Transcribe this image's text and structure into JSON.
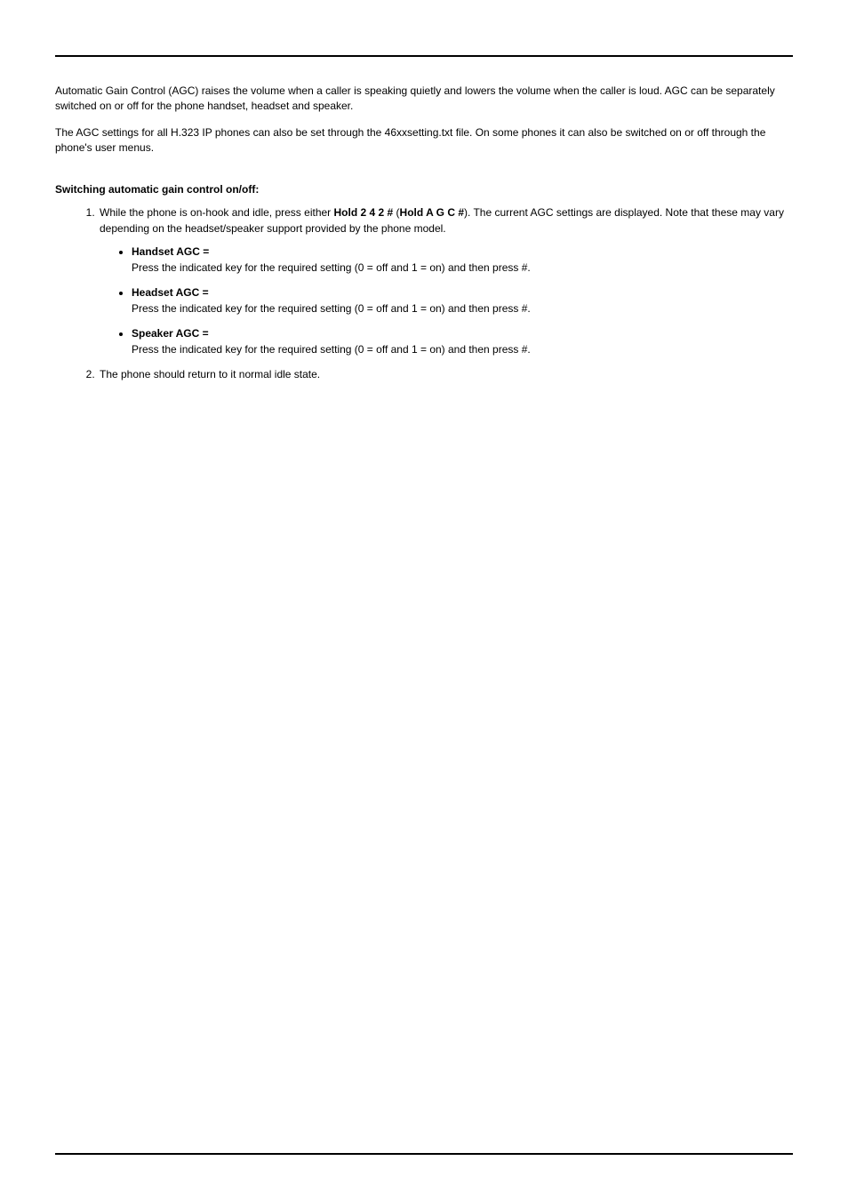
{
  "intro_para_1": "Automatic Gain Control (AGC) raises the volume when a caller is speaking quietly and lowers the volume when the caller is loud. AGC can be separately switched on or off for the phone handset, headset and speaker.",
  "intro_para_2": "The AGC settings for all H.323 IP phones can also be set through the 46xxsetting.txt file. On some phones it can also be switched on or off through the phone's user menus.",
  "section_heading": "Switching automatic gain control on/off:",
  "step1_pre": "While the phone is on-hook and idle, press either ",
  "step1_bold1": "Hold 2 4 2 #",
  "step1_mid": " (",
  "step1_bold2": "Hold A G C #",
  "step1_post": "). The current AGC settings are displayed. Note that these may vary depending on the headset/speaker support provided by the phone model.",
  "bullets": [
    {
      "label": "Handset AGC =",
      "desc": "Press the indicated key for the required setting (0 = off and 1 = on) and then press #."
    },
    {
      "label": "Headset AGC =",
      "desc": "Press the indicated key for the required setting (0 = off and 1 = on) and then press #."
    },
    {
      "label": "Speaker AGC =",
      "desc": "Press the indicated key for the required setting (0 = off and 1 = on) and then press #."
    }
  ],
  "step2": "The phone should return to it normal idle state."
}
